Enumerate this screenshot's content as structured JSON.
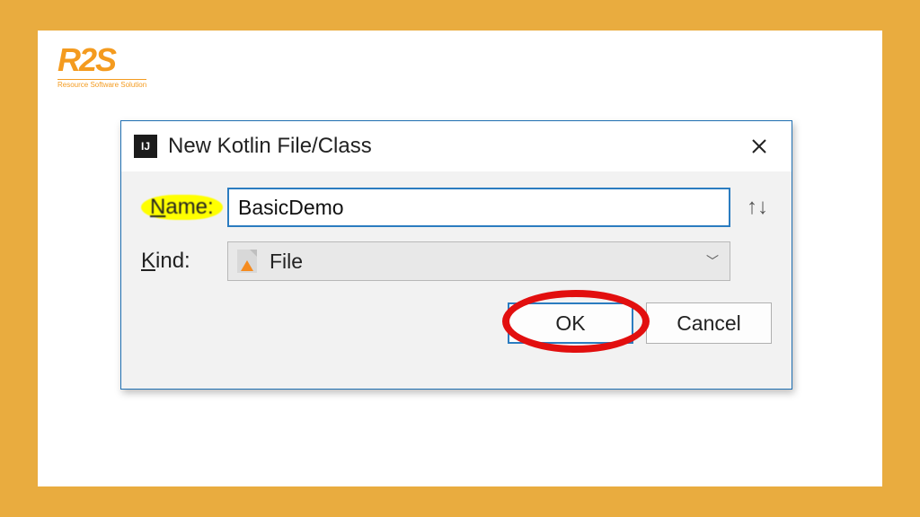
{
  "logo": {
    "text": "R2S",
    "subtitle": "Resource Software Solution"
  },
  "dialog": {
    "title": "New Kotlin File/Class",
    "nameLabel": "Name:",
    "nameValue": "BasicDemo",
    "kindLabel": "Kind:",
    "kindValue": "File",
    "okLabel": "OK",
    "cancelLabel": "Cancel",
    "appIconText": "IJ"
  }
}
